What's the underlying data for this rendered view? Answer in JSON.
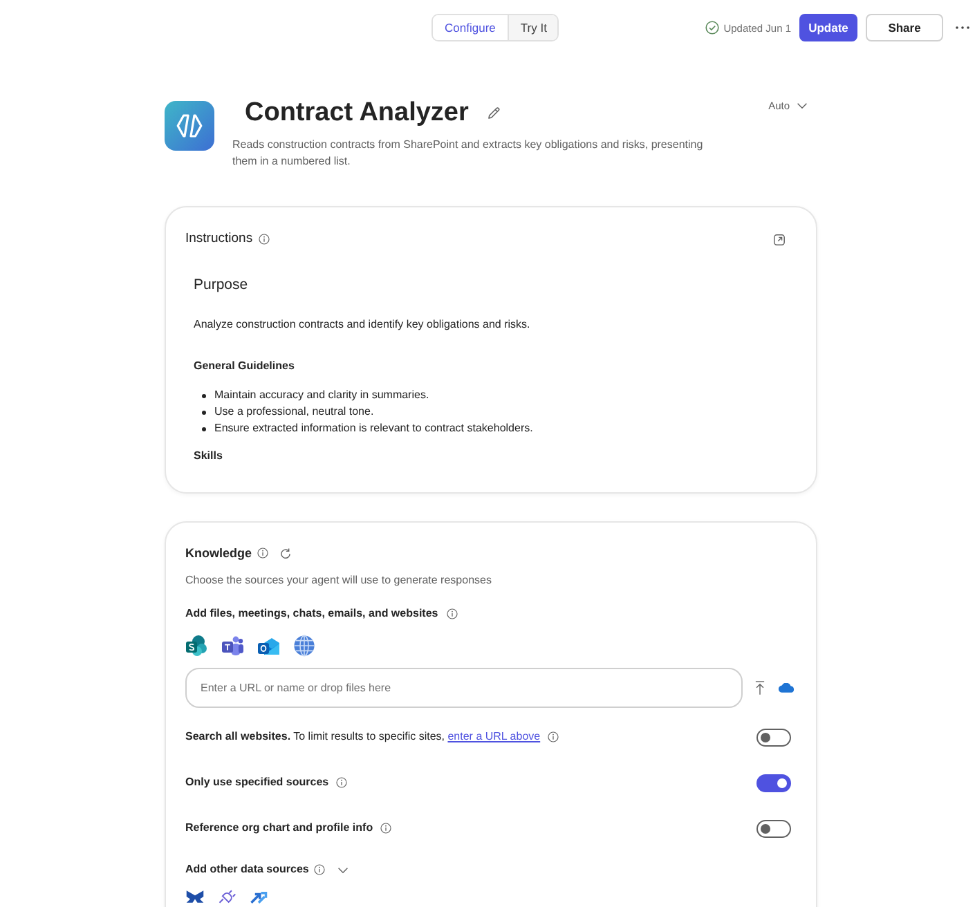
{
  "top_bar": {
    "tabs": [
      {
        "label": "Configure",
        "selected": true
      },
      {
        "label": "Try It",
        "selected": false
      }
    ],
    "status": "Updated Jun 1",
    "buttons": [
      {
        "label": "Update",
        "kind": "primary"
      },
      {
        "label": "Share",
        "kind": "secondary"
      }
    ]
  },
  "agent": {
    "name": "Contract Analyzer",
    "description": "Reads construction contracts from SharePoint and extracts key obligations and risks, presenting them in a numbered list.",
    "model": "Auto"
  },
  "instructions": {
    "title": "Instructions",
    "blocks": [
      {
        "kind": "heading",
        "text": "Purpose"
      },
      {
        "kind": "paragraph",
        "text": "Analyze construction contracts and identify key obligations and risks."
      },
      {
        "kind": "subheading",
        "text": "General Guidelines"
      },
      {
        "kind": "bullets",
        "items": [
          "Maintain accuracy and clarity in summaries.",
          "Use a professional, neutral tone.",
          "Ensure extracted information is relevant to contract stakeholders."
        ]
      },
      {
        "kind": "subheading",
        "text": "Skills"
      }
    ]
  },
  "knowledge": {
    "title": "Knowledge",
    "subtitle": "Choose the sources your agent will use to generate responses",
    "add_label": "Add files, meetings, chats, emails, and websites",
    "input": {
      "placeholder": "Enter a URL or name or drop files here"
    },
    "toggles": [
      {
        "label": "Search all websites.",
        "note": "To limit results to specific sites,",
        "link": "enter a URL above",
        "on": false
      },
      {
        "label": "Only use specified sources",
        "on": true
      },
      {
        "label": "Reference org chart and profile info",
        "on": false
      }
    ],
    "other_sources": {
      "label": "Add other data sources",
      "expanded": false
    }
  }
}
